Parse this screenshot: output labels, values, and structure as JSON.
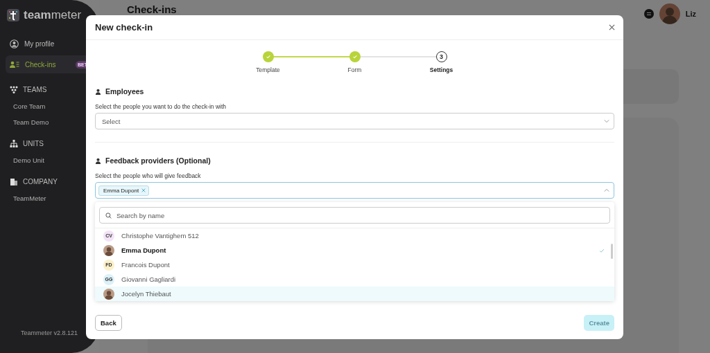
{
  "sidebar": {
    "logo": "**team**meter",
    "items": [
      {
        "label": "My profile",
        "kind": "profile",
        "selected": false
      },
      {
        "label": "Check-ins",
        "kind": "checkins",
        "selected": true,
        "badge": "BET"
      }
    ],
    "sections": [
      {
        "title": "TEAMS",
        "kind": "teams",
        "items": [
          "Core Team",
          "Team Demo"
        ]
      },
      {
        "title": "UNITS",
        "kind": "units",
        "items": [
          "Demo Unit"
        ]
      },
      {
        "title": "COMPANY",
        "kind": "company",
        "items": [
          "TeamMeter"
        ]
      }
    ],
    "version": "Teammeter v2.8.121"
  },
  "header": {
    "title": "Check-ins",
    "user": "Liz"
  },
  "modal": {
    "title": "New check-in",
    "steps": [
      {
        "label": "Template",
        "kind": "done"
      },
      {
        "label": "Form",
        "kind": "done"
      },
      {
        "label": "Settings",
        "kind": "current",
        "number": "3"
      }
    ],
    "employees": {
      "heading": "Employees",
      "label": "Select the people you want to do the check-in with",
      "placeholder": "Select"
    },
    "feedback": {
      "heading": "Feedback providers (Optional)",
      "label": "Select the people who will give feedback",
      "tags": [
        "Emma Dupont"
      ],
      "expanded": true
    },
    "dropdown": {
      "search_placeholder": "Search by name",
      "options": [
        {
          "name": "Christophe Vantighem 512",
          "kind": "initials",
          "initials": "CV",
          "color": "#f3e3f7",
          "selected": false,
          "highlighted": false
        },
        {
          "name": "Emma Dupont",
          "kind": "photo",
          "selected": true,
          "highlighted": false
        },
        {
          "name": "Francois Dupont",
          "kind": "initials",
          "initials": "FD",
          "color": "#fbf0c9",
          "selected": false,
          "highlighted": false
        },
        {
          "name": "Giovanni Gagliardi",
          "kind": "initials",
          "initials": "GG",
          "color": "#dcf1f8",
          "selected": false,
          "highlighted": false
        },
        {
          "name": "Jocelyn Thiebaut",
          "kind": "photo",
          "selected": false,
          "highlighted": true
        }
      ]
    },
    "buttons": {
      "back": "Back",
      "create": "Create",
      "create_disabled": true
    }
  }
}
